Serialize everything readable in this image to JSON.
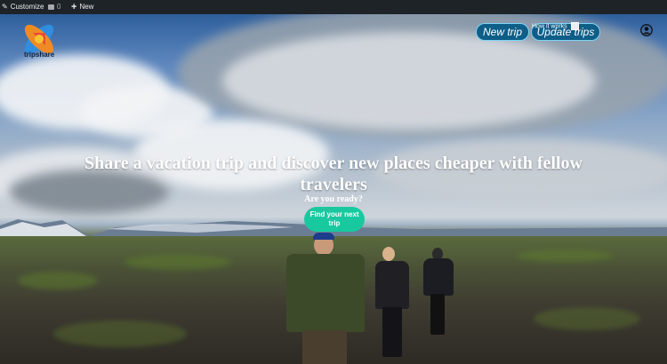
{
  "admin_bar": {
    "customize_label": "Customize",
    "comments_count": "0",
    "new_label": "New"
  },
  "brand": {
    "name": "tripshare",
    "colors": {
      "orange": "#f08a24",
      "red": "#e8423c",
      "blue": "#2f8ee0",
      "yellow": "#f6c330"
    }
  },
  "header": {
    "new_trip_label": "New trip",
    "update_trips_label": "Update trips",
    "overlay_nav_text": "How it works",
    "account_icon": "user-circle-icon"
  },
  "hero": {
    "headline": "Share a vacation trip and discover new places cheaper with fellow travelers",
    "subheadline": "Are you ready?",
    "cta_label": "Find your next trip"
  },
  "colors": {
    "cta": "#18c9a0",
    "header_button": "#0e5e88",
    "admin_bar": "#1d2327"
  }
}
